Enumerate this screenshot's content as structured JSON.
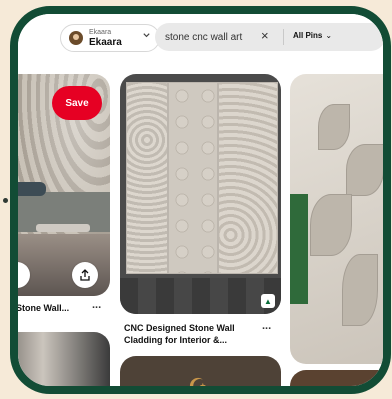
{
  "header": {
    "account_small": "Ekaara",
    "account_name": "Ekaara",
    "account_chevron": "chevron-down-icon",
    "search_value": "stone cnc wall art",
    "clear_icon": "×",
    "filter_label": "All Pins",
    "filter_chevron": "⌄"
  },
  "pins": {
    "left": {
      "save_label": "Save",
      "caption": "Stone Wall...",
      "more": "...",
      "share_icon": "share-icon"
    },
    "middle": {
      "caption": "CNC Designed Stone Wall Cladding for Interior &...",
      "more": "..."
    }
  },
  "colors": {
    "frame": "#124c35",
    "background": "#f6ead8",
    "save_button": "#e60023"
  }
}
